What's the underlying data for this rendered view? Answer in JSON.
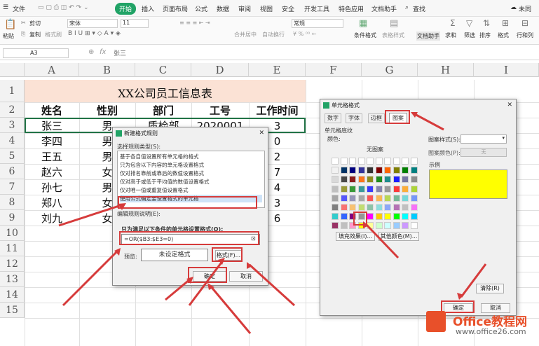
{
  "menu": {
    "file": "文件",
    "tabs": [
      "开始",
      "插入",
      "页面布局",
      "公式",
      "数据",
      "审阅",
      "视图",
      "安全",
      "开发工具",
      "特色应用",
      "文档助手"
    ],
    "search": "查找",
    "cloud": "未同"
  },
  "ribbon": {
    "cut": "剪切",
    "paste": "粘贴",
    "copy": "复制",
    "format_painter": "格式刷",
    "font": "宋体",
    "size": "11",
    "merge": "合并居中",
    "wrap": "自动换行",
    "numfmt": "常规",
    "cond": "条件格式",
    "tablestyle": "表格样式",
    "doc": "文档助手",
    "sum": "求和",
    "filter": "筛选",
    "sort": "排序",
    "format": "格式",
    "rowcol": "行和列"
  },
  "formula_bar": {
    "cell_ref": "A3",
    "fx": "fx",
    "value": "张三"
  },
  "columns": [
    "A",
    "B",
    "C",
    "D",
    "E",
    "F",
    "G",
    "H",
    "I"
  ],
  "rows": [
    "1",
    "2",
    "3",
    "4",
    "5",
    "6",
    "7",
    "8",
    "9",
    "10",
    "11",
    "12",
    "13",
    "14",
    "15"
  ],
  "sheet": {
    "title": "XX公司员工信息表",
    "headers": [
      "姓名",
      "性别",
      "部门",
      "工号",
      "工作时间"
    ],
    "names": [
      "张三",
      "李四",
      "王五",
      "赵六",
      "孙七",
      "郑八",
      "刘九"
    ],
    "genders": [
      "男",
      "男",
      "男",
      "女",
      "男",
      "女",
      "女"
    ],
    "dept_row3": "质检部",
    "id_row3": "2020001",
    "years": [
      "3",
      "0",
      "2",
      "7",
      "4",
      "3",
      "6"
    ]
  },
  "rule_dialog": {
    "title": "新建格式规则",
    "select_type": "选择规则类型(S):",
    "items": [
      "基于各自值设置所有单元格的格式",
      "只为包含以下内容的单元格设置格式",
      "仅对排名靠前或靠后的数值设置格式",
      "仅对高于或低于平均值的数值设置格式",
      "仅对唯一值或重复值设置格式",
      "使用公式确定要设置格式的单元格"
    ],
    "edit_desc": "编辑规则说明(E):",
    "formula_label": "只为满足以下条件的单元格设置格式(O):",
    "formula": "=OR($B3:$E3=0)",
    "preview_label": "预览:",
    "preview": "未设定格式",
    "format_btn": "格式(F)...",
    "ok": "确定",
    "cancel": "取消"
  },
  "cell_dialog": {
    "title": "单元格格式",
    "tabs": [
      "数字",
      "字体",
      "边框",
      "图案"
    ],
    "shading": "单元格底纹",
    "color": "颜色:",
    "no_color": "无图案",
    "pattern_style": "图案样式(S):",
    "pattern_color": "图案颜色(P):",
    "pattern_color_value": "无",
    "sample": "示例",
    "fill_effect": "填充效果(I)...",
    "more_colors": "其他颜色(M)...",
    "clear": "清除(R)",
    "ok": "确定",
    "cancel": "取消",
    "sample_color": "#ffff00"
  },
  "watermark": {
    "brand": "Office教程网",
    "url": "www.office26.com"
  },
  "colors": {
    "accent_green": "#21a366",
    "title_fill": "#fbe2d5",
    "sel_green": "#217346",
    "arrow": "#d63b3b",
    "palette": [
      "#000000",
      "#993300",
      "#333300",
      "#003300",
      "#003366",
      "#000080",
      "#333399",
      "#333333",
      "#800000",
      "#ff6600",
      "#808000",
      "#008000",
      "#008080",
      "#0000ff",
      "#666699",
      "#808080",
      "#ff0000",
      "#ff9900",
      "#99cc00",
      "#339966",
      "#33cccc",
      "#3366ff",
      "#800080",
      "#969696",
      "#ff00ff",
      "#ffcc00",
      "#ffff00",
      "#00ff00",
      "#00ffff",
      "#00ccff",
      "#993366",
      "#c0c0c0",
      "#ff99cc",
      "#ffcc99",
      "#ffff99",
      "#ccffcc",
      "#ccffff",
      "#99ccff",
      "#cc99ff",
      "#ffffff"
    ]
  }
}
